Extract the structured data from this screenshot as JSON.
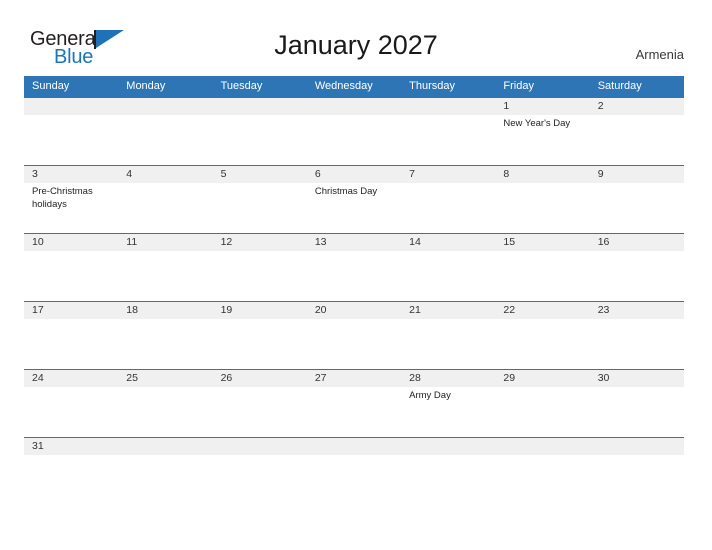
{
  "brand": {
    "name_part1": "General",
    "name_part2": "Blue",
    "colors": {
      "dark": "#231f20",
      "blue": "#1b75bb",
      "flag": "#2072b8"
    }
  },
  "header": {
    "title": "January 2027",
    "country": "Armenia"
  },
  "colors": {
    "header_blue": "#2e75b6",
    "date_strip": "#f0f0f0",
    "text": "#333333"
  },
  "calendar": {
    "day_names": [
      "Sunday",
      "Monday",
      "Tuesday",
      "Wednesday",
      "Thursday",
      "Friday",
      "Saturday"
    ],
    "weeks": [
      {
        "dates": [
          "",
          "",
          "",
          "",
          "",
          "1",
          "2"
        ],
        "events": [
          "",
          "",
          "",
          "",
          "",
          "New Year's Day",
          ""
        ]
      },
      {
        "dates": [
          "3",
          "4",
          "5",
          "6",
          "7",
          "8",
          "9"
        ],
        "events": [
          "Pre-Christmas holidays",
          "",
          "",
          "Christmas Day",
          "",
          "",
          ""
        ]
      },
      {
        "dates": [
          "10",
          "11",
          "12",
          "13",
          "14",
          "15",
          "16"
        ],
        "events": [
          "",
          "",
          "",
          "",
          "",
          "",
          ""
        ]
      },
      {
        "dates": [
          "17",
          "18",
          "19",
          "20",
          "21",
          "22",
          "23"
        ],
        "events": [
          "",
          "",
          "",
          "",
          "",
          "",
          ""
        ]
      },
      {
        "dates": [
          "24",
          "25",
          "26",
          "27",
          "28",
          "29",
          "30"
        ],
        "events": [
          "",
          "",
          "",
          "",
          "Army Day",
          "",
          ""
        ]
      },
      {
        "dates": [
          "31",
          "",
          "",
          "",
          "",
          "",
          ""
        ],
        "events": [
          "",
          "",
          "",
          "",
          "",
          "",
          ""
        ]
      }
    ]
  }
}
